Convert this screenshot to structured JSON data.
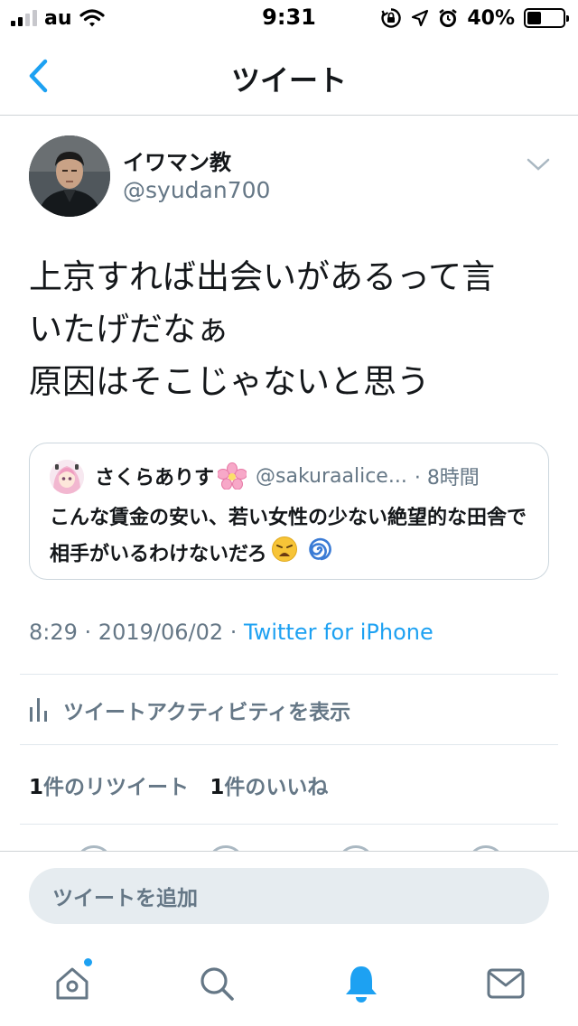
{
  "status_bar": {
    "carrier": "au",
    "time": "9:31",
    "battery_pct": "40%",
    "battery_level": 0.4
  },
  "nav": {
    "title": "ツイート"
  },
  "tweet": {
    "author_name": "イワマン教",
    "author_handle": "@syudan700",
    "text": "上京すれば出会いがあるって言\nいたげだなぁ\n原因はそこじゃないと思う",
    "time": "8:29",
    "date": "2019/06/02",
    "source": "Twitter for iPhone"
  },
  "quote": {
    "name": "さくらありす",
    "handle": "@sakuraalice...",
    "time": "8時間",
    "text": "こんな賃金の安い、若い女性の少ない絶望的な田舎で相手がいるわけないだろ"
  },
  "activity": {
    "label": "ツイートアクティビティを表示"
  },
  "stats": {
    "retweet_count": "1",
    "retweet_label": "件のリツイート",
    "like_count": "1",
    "like_label": "件のいいね"
  },
  "compose": {
    "placeholder": "ツイートを追加"
  },
  "tabbar": {
    "active": "notifications",
    "accent": "#1da1f2"
  }
}
